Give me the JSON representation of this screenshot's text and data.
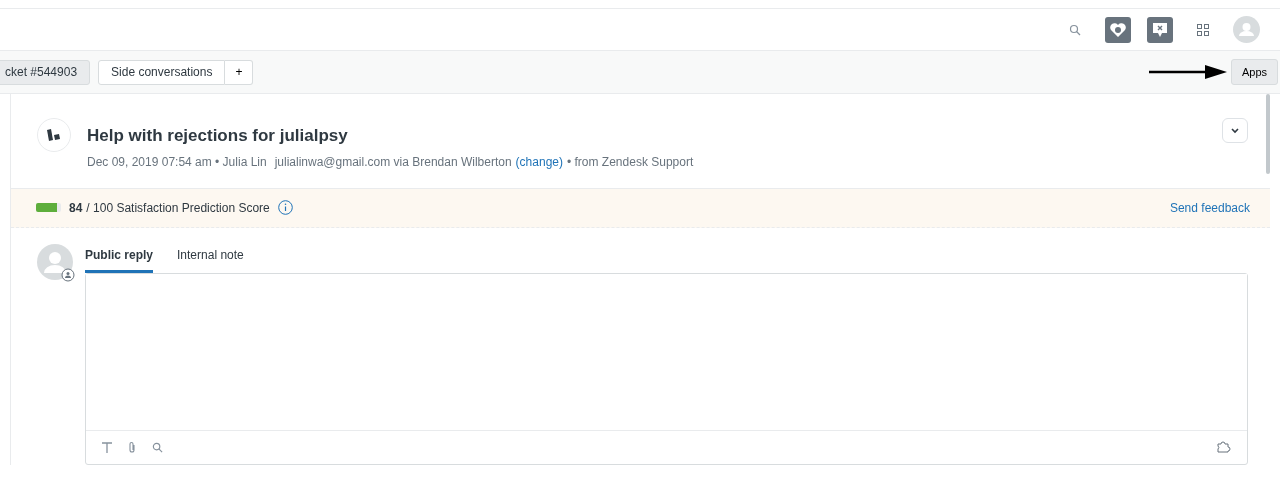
{
  "tabs": [
    {
      "label": "cket #544903",
      "selected": true
    },
    {
      "label": "Side conversations",
      "selected": false
    }
  ],
  "add_tab": "+",
  "apps_button": "Apps",
  "ticket": {
    "title": "Help with rejections for julialpsy",
    "meta": "Dec 09, 2019 07:54 am • Julia Lin",
    "via": "julialinwa@gmail.com via Brendan Wilberton",
    "change_link": "(change)",
    "source": "• from Zendesk Support"
  },
  "satisfaction": {
    "score": "84",
    "label": "/ 100 Satisfaction Prediction Score",
    "level": 0.84,
    "feedback_link": "Send feedback"
  },
  "composer_tabs": [
    {
      "label": "Public reply",
      "selected": true
    },
    {
      "label": "Internal note",
      "selected": false
    }
  ]
}
